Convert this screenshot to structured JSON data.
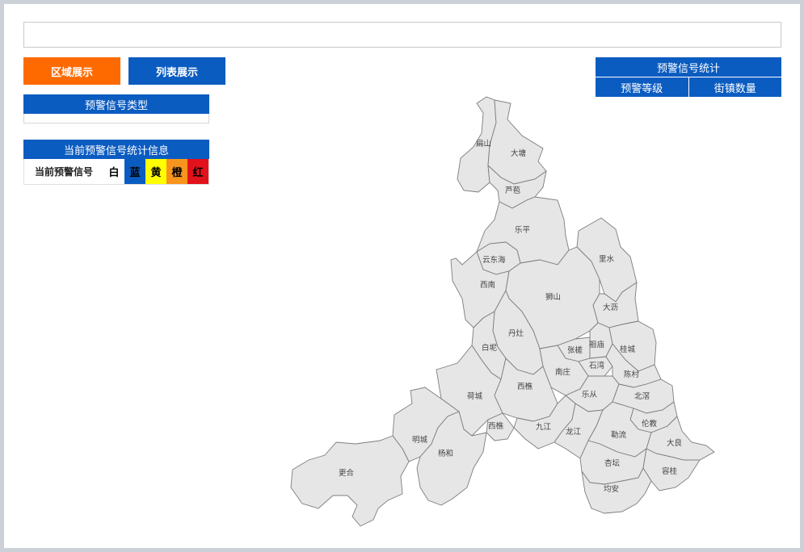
{
  "search": {
    "value": ""
  },
  "buttons": {
    "region_view": "区域展示",
    "list_view": "列表展示"
  },
  "signal_type_panel": {
    "title": "预警信号类型"
  },
  "current_info": {
    "title": "当前预警信号统计信息",
    "label": "当前预警信号",
    "signals": [
      {
        "name": "白",
        "color": "#ffffff",
        "text_color": "#000000"
      },
      {
        "name": "蓝",
        "color": "#0b5cc1",
        "text_color": "#000000"
      },
      {
        "name": "黄",
        "color": "#ffff00",
        "text_color": "#000000"
      },
      {
        "name": "橙",
        "color": "#f7941d",
        "text_color": "#000000"
      },
      {
        "name": "红",
        "color": "#e2121c",
        "text_color": "#000000"
      }
    ]
  },
  "stats": {
    "title": "预警信号统计",
    "col_level": "预警等级",
    "col_count": "街镇数量"
  },
  "map": {
    "regions": [
      "扁山",
      "大塘",
      "芦苞",
      "乐平",
      "云东海",
      "西南",
      "狮山",
      "里水",
      "大沥",
      "丹灶",
      "白坭",
      "张槎",
      "祖庙",
      "桂城",
      "石湾",
      "南庄",
      "陈村",
      "荷城",
      "西樵",
      "乐从",
      "北滘",
      "九江",
      "龙江",
      "伦教",
      "勒流",
      "大良",
      "明城",
      "杨和",
      "更合",
      "杏坛",
      "容桂",
      "均安"
    ]
  },
  "colors": {
    "accent_orange": "#ff6a00",
    "accent_blue": "#0b5cc1",
    "map_fill": "#e6e6e6"
  }
}
